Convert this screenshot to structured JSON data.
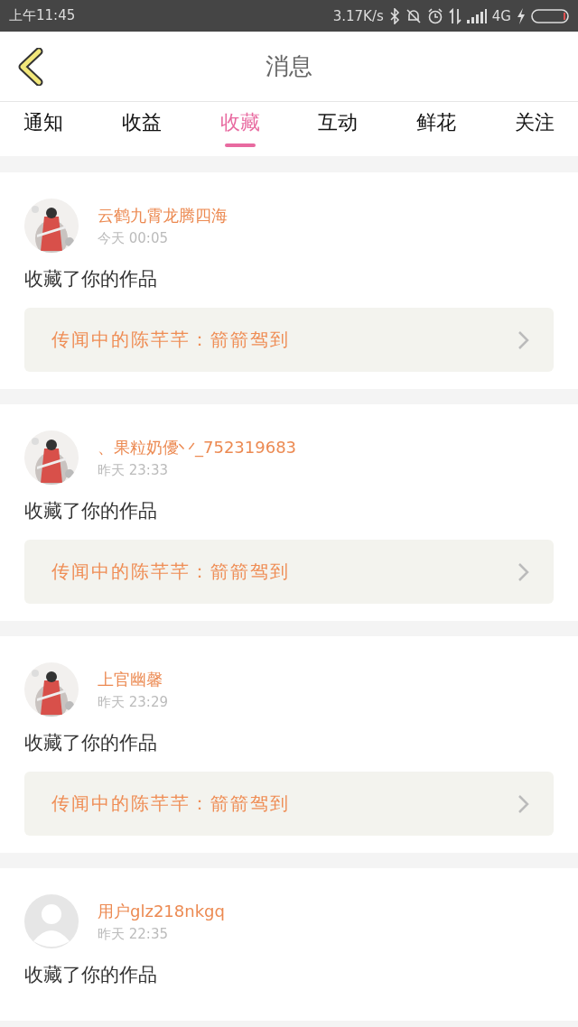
{
  "status_bar": {
    "time": "上午11:45",
    "speed": "3.17K/s",
    "network": "4G"
  },
  "header": {
    "title": "消息"
  },
  "tabs": [
    {
      "label": "通知",
      "selected": false
    },
    {
      "label": "收益",
      "selected": false
    },
    {
      "label": "收藏",
      "selected": true
    },
    {
      "label": "互动",
      "selected": false
    },
    {
      "label": "鲜花",
      "selected": false
    },
    {
      "label": "关注",
      "selected": false
    }
  ],
  "messages": [
    {
      "name": "云鹤九霄龙腾四海",
      "time": "今天 00:05",
      "action": "收藏了你的作品",
      "link": {
        "title": "传闻中的陈芊芊：箭箭驾到"
      }
    },
    {
      "name": "、果粒奶優丷_752319683",
      "time": "昨天 23:33",
      "action": "收藏了你的作品",
      "link": {
        "title": "传闻中的陈芊芊：箭箭驾到"
      }
    },
    {
      "name": "上官幽馨",
      "time": "昨天 23:29",
      "action": "收藏了你的作品",
      "link": {
        "title": "传闻中的陈芊芊：箭箭驾到"
      }
    },
    {
      "avatar": {
        "kind": "default"
      },
      "name": "用户glz218nkgq",
      "time": "昨天 22:35",
      "action": "收藏了你的作品"
    }
  ]
}
